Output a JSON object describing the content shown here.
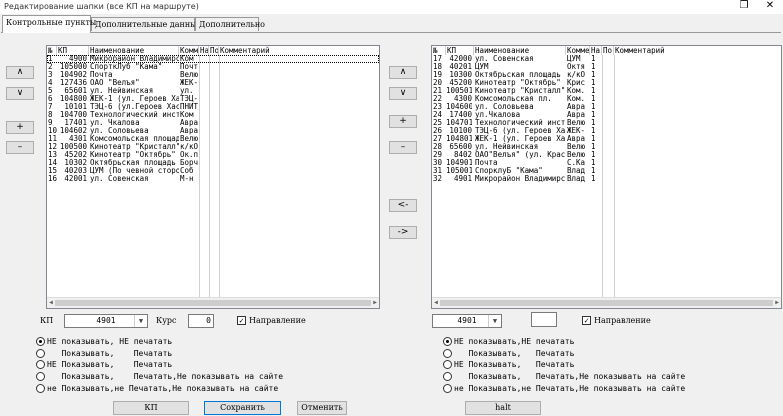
{
  "window": {
    "title": "Редактирование шапки (все КП на маршруте)",
    "restore_glyph": "❐",
    "close_glyph": "✕"
  },
  "tabs": [
    {
      "label": "Контрольные пункты",
      "active": true
    },
    {
      "label": "Дополнительные данные",
      "active": false
    },
    {
      "label": "Дополнительно",
      "active": false
    }
  ],
  "arrows": {
    "up": "∧",
    "down": "∨",
    "add": "+",
    "remove": "–",
    "move_left": "<-",
    "move_right": "->"
  },
  "columns": [
    "№",
    "КП",
    "Наименование",
    "Комментарий",
    "На",
    "По",
    "Комментарий"
  ],
  "left_rows": [
    [
      "1",
      "4900",
      "Микрорайон Владимирс",
      "Ком",
      "",
      "",
      ""
    ],
    [
      "2",
      "105000",
      "СпорткЛуб \"Кама\"",
      "Почт",
      "",
      "",
      ""
    ],
    [
      "3",
      "104902",
      "Почта",
      "Велю",
      "",
      "",
      ""
    ],
    [
      "4",
      "127436",
      "ОАО \"Велъя\"",
      "ЖЕК-",
      "",
      "",
      ""
    ],
    [
      "5",
      "65601",
      "ул. Нейвинская",
      "ул.",
      "",
      "",
      ""
    ],
    [
      "6",
      "104800",
      "ЖЕК-1 (ул. Героев Хас",
      "ТЭЦ-",
      "",
      "",
      ""
    ],
    [
      "7",
      "10101",
      "ТЭЦ-6 (ул.Героев Хас",
      "ПНИТ",
      "",
      "",
      ""
    ],
    [
      "8",
      "104700",
      "Технологический инст",
      "Ком",
      "",
      "",
      ""
    ],
    [
      "9",
      "17401",
      "ул. Чкалова",
      "Авра",
      "",
      "",
      ""
    ],
    [
      "10",
      "104602",
      "ул. Соловьева",
      "Авра",
      "",
      "",
      ""
    ],
    [
      "11",
      "4301",
      "Комсомольская площад",
      "Велю",
      "",
      "",
      ""
    ],
    [
      "12",
      "100500",
      "Кинотеатр \"Кристалл\"",
      "к/кО",
      "",
      "",
      ""
    ],
    [
      "13",
      "45202",
      "Кинотеатр \"Октябрь\"",
      "Ок.п",
      "",
      "",
      ""
    ],
    [
      "14",
      "10302",
      "Октябрьская площадь",
      "Борч",
      "",
      "",
      ""
    ],
    [
      "15",
      "40203",
      "ЦУМ (По чевной сторо",
      "Соб",
      "",
      "",
      ""
    ],
    [
      "16",
      "42001",
      "ул. Совенская",
      "М-н",
      "",
      "",
      ""
    ]
  ],
  "right_rows": [
    [
      "17",
      "42000",
      "ул. Совенская",
      "ЦУМ",
      "1",
      "",
      ""
    ],
    [
      "18",
      "40201",
      "ЦУМ",
      "Октя",
      "1",
      "",
      ""
    ],
    [
      "19",
      "10300",
      "Октябрьская площадь",
      "к/кО",
      "1",
      "",
      ""
    ],
    [
      "20",
      "45200",
      "Кинотеатр \"Октябрь\"",
      "Крис",
      "1",
      "",
      ""
    ],
    [
      "21",
      "100501",
      "Кинотеатр \"Кристалл\"",
      "Ком.",
      "1",
      "",
      ""
    ],
    [
      "22",
      "4300",
      "Комсомольская пл.",
      "Ком.",
      "1",
      "",
      ""
    ],
    [
      "23",
      "104600",
      "ул. Соловьева",
      "Авра",
      "1",
      "",
      ""
    ],
    [
      "24",
      "17400",
      "ул.Чкалова",
      "Авра",
      "1",
      "",
      ""
    ],
    [
      "25",
      "104701",
      "Технологический инст",
      "Велю",
      "1",
      "",
      ""
    ],
    [
      "26",
      "10100",
      "ТЭЦ-6 (ул. Героев Хас",
      "ЖЕК-",
      "1",
      "",
      ""
    ],
    [
      "27",
      "104801",
      "ЖЕК-1 (ул. Героев Хас",
      "Авра",
      "1",
      "",
      ""
    ],
    [
      "28",
      "65600",
      "ул. Нейвинская",
      "Велю",
      "1",
      "",
      ""
    ],
    [
      "29",
      "8402",
      "ОАО\"Велъя\" (ул. Крас",
      "Велю",
      "1",
      "",
      ""
    ],
    [
      "30",
      "104901",
      "Почта",
      "С.Ка",
      "1",
      "",
      ""
    ],
    [
      "31",
      "105001",
      "СпорклуБ \"Кама\"",
      "Влад",
      "1",
      "",
      ""
    ],
    [
      "32",
      "4901",
      "Микрорайон Владимирс",
      "Влад",
      "1",
      "",
      ""
    ]
  ],
  "left_controls": {
    "kp_label": "КП",
    "kp_value": "4901",
    "course_label": "Курс",
    "course_value": "0",
    "direction_label": "Направление",
    "direction_checked": true
  },
  "right_controls": {
    "kp_value": "4901",
    "course_value": "",
    "direction_label": "Направление",
    "direction_checked": true
  },
  "radio_options": [
    "НЕ показывать, НЕ печатать",
    "   Показывать,    Печатать",
    "НЕ Показывать,    Печатать",
    "   Показывать,    Печатать,Не показывать на сайте",
    "не Показывать,не Печатать,Не показывать на сайте"
  ],
  "left_radio_labels": [
    "НЕ показывать, НЕ печатать",
    "   Показывать,    Печатать",
    "НЕ Показывать,    Печатать",
    "   Показывать,    Печатать,Не показывать на сайте",
    "не Показывать,не Печатать,Не показывать на сайте"
  ],
  "right_radio_labels": [
    "НЕ показывать,НЕ печатать",
    "   Показывать,   Печатать",
    "НЕ Показывать,   Печатать",
    "   Показывать,   Печатать,Не показывать на сайте",
    "не Показывать,не Печатать,Не показывать на сайте"
  ],
  "left_radio_selected": 0,
  "right_radio_selected": 0,
  "bottom_buttons": {
    "kp": "КП",
    "save": "Сохранить",
    "cancel": "Отменить",
    "halt": "halt"
  }
}
